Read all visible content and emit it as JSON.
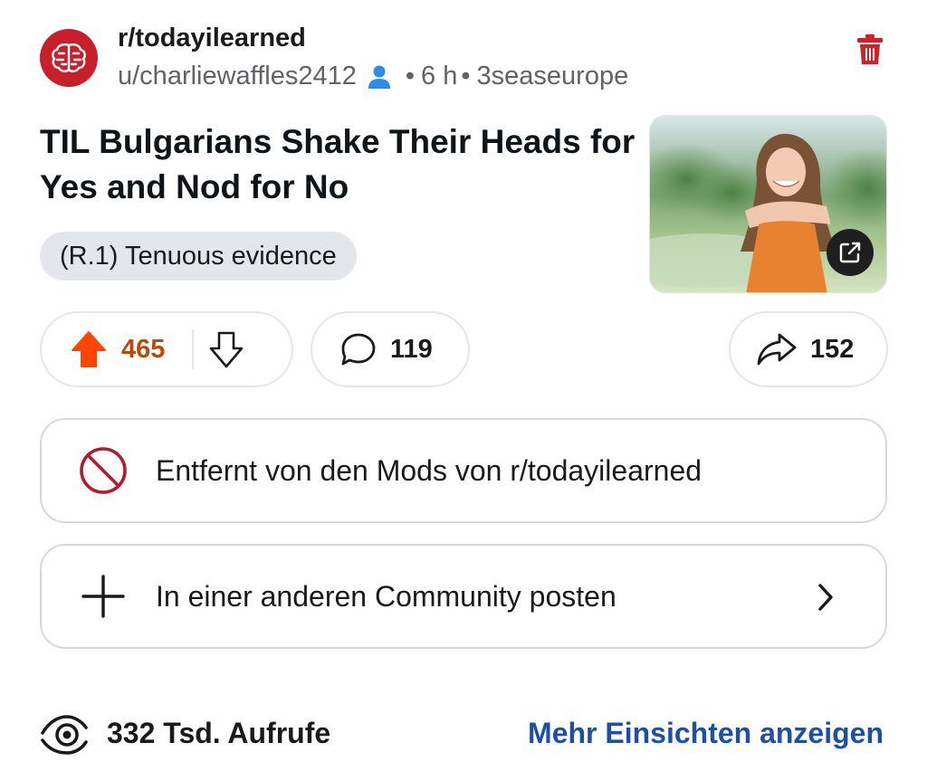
{
  "post": {
    "subreddit": "r/todayilearned",
    "author": "u/charliewaffles2412",
    "age": "6 h",
    "flag_user": "3seaseurope",
    "title": "TIL Bulgarians Shake Their Heads for Yes and Nod for No",
    "flair": "(R.1) Tenuous evidence"
  },
  "actions": {
    "upvotes": "465",
    "comments": "119",
    "shares": "152"
  },
  "status": {
    "removed_text": "Entfernt von den Mods von r/todayilearned",
    "crosspost_text": "In einer anderen Community posten"
  },
  "footer": {
    "views": "332 Tsd. Aufrufe",
    "insights_link": "Mehr Einsichten anzeigen"
  },
  "icons": {
    "subreddit_avatar": "brain-icon",
    "author_badge": "person-icon",
    "delete": "trash-icon",
    "upvote": "arrow-up-icon",
    "downvote": "arrow-down-icon",
    "comment": "speech-bubble-icon",
    "share": "share-arrow-icon",
    "removed": "prohibited-icon",
    "crosspost": "plus-icon",
    "external_link": "external-link-icon",
    "views": "eye-icon"
  },
  "colors": {
    "subreddit_avatar": "#c8202a",
    "delete": "#d0202a",
    "upvote": "#ff4500",
    "vote_count": "#b94a0c",
    "removed_icon": "#b01c2e",
    "author_badge": "#2a8ee8",
    "insights_link": "#1e4fa0"
  }
}
